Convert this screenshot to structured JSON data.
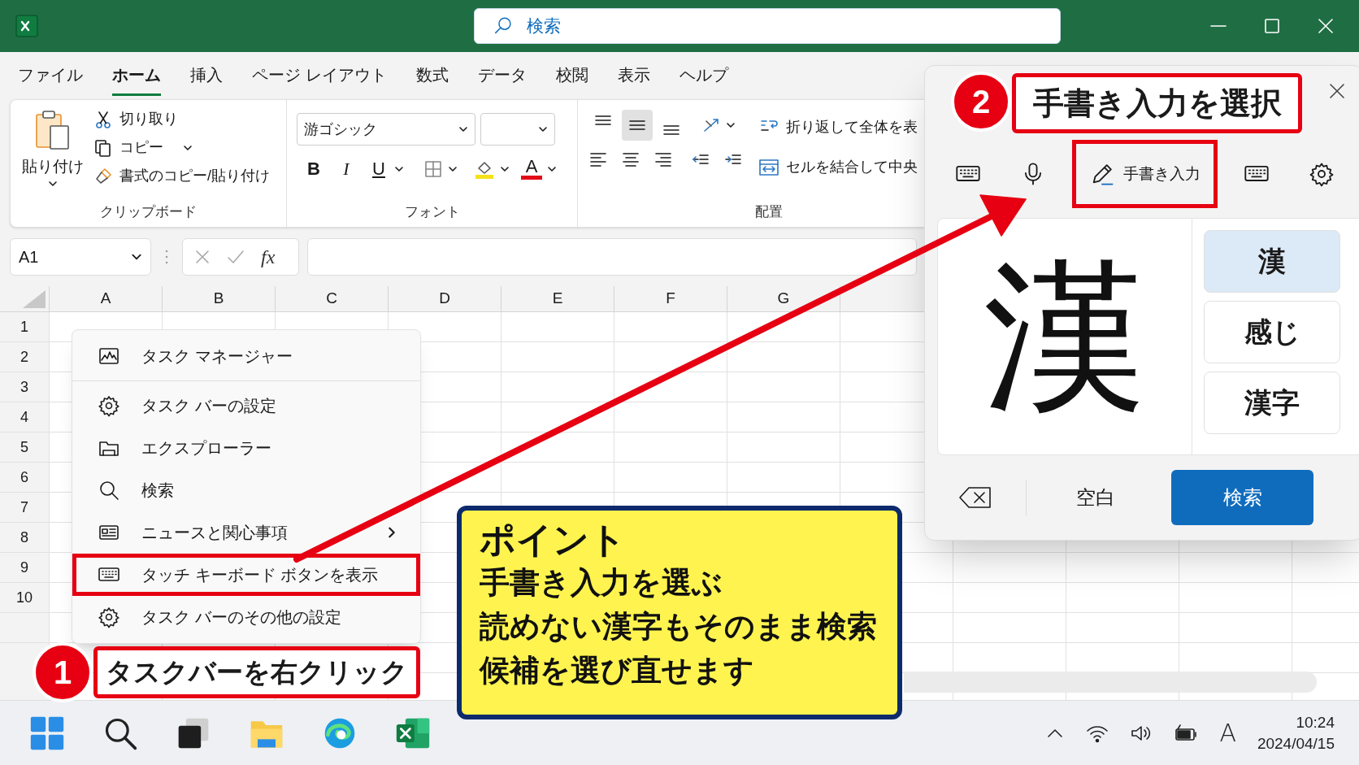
{
  "search": {
    "placeholder": "検索"
  },
  "ribbon_tabs": [
    {
      "label": "ファイル",
      "selected": false
    },
    {
      "label": "ホーム",
      "selected": true
    },
    {
      "label": "挿入",
      "selected": false
    },
    {
      "label": "ページ レイアウト",
      "selected": false
    },
    {
      "label": "数式",
      "selected": false
    },
    {
      "label": "データ",
      "selected": false
    },
    {
      "label": "校閲",
      "selected": false
    },
    {
      "label": "表示",
      "selected": false
    },
    {
      "label": "ヘルプ",
      "selected": false
    }
  ],
  "ribbon": {
    "clipboard": {
      "paste": "貼り付け",
      "commands": [
        {
          "kind": "cut",
          "label": "切り取り"
        },
        {
          "kind": "copy",
          "label": "コピー"
        },
        {
          "kind": "painter",
          "label": "書式のコピー/貼り付け"
        }
      ],
      "label": "クリップボード"
    },
    "font": {
      "font_name": "游ゴシック",
      "buttons": [
        "B",
        "I",
        "U"
      ],
      "font_color_button": "A",
      "label": "フォント"
    },
    "alignment": {
      "align_buttons": [
        {
          "kind": "top",
          "selected": false
        },
        {
          "kind": "middle",
          "selected": true
        },
        {
          "kind": "bottom",
          "selected": false
        }
      ],
      "commands": [
        {
          "kind": "wrap",
          "label": "折り返して全体を表"
        },
        {
          "kind": "merge",
          "label": "セルを結合して中央"
        }
      ],
      "label": "配置"
    }
  },
  "formula_bar": {
    "name_box": "A1",
    "function_button": "fx"
  },
  "sheet": {
    "columns": [
      "A",
      "B",
      "C",
      "D",
      "E",
      "F",
      "G"
    ],
    "rows": [
      "1",
      "2",
      "3",
      "4",
      "5",
      "6",
      "7",
      "8",
      "9",
      "10"
    ]
  },
  "context_menu": [
    {
      "kind": "taskmanager",
      "label": "タスク マネージャー",
      "submenu": false,
      "highlighted": false
    },
    {
      "kind": "settings",
      "label": "タスク バーの設定",
      "submenu": false,
      "highlighted": false
    },
    {
      "kind": "folder",
      "label": "エクスプローラー",
      "submenu": false,
      "highlighted": false
    },
    {
      "kind": "search",
      "label": "検索",
      "submenu": false,
      "highlighted": false
    },
    {
      "kind": "news",
      "label": "ニュースと関心事項",
      "submenu": true,
      "highlighted": false
    },
    {
      "kind": "keyboard",
      "label": "タッチ キーボード ボタンを表示",
      "submenu": false,
      "highlighted": true
    },
    {
      "kind": "settings",
      "label": "タスク バーのその他の設定",
      "submenu": false,
      "highlighted": false
    }
  ],
  "handwriting_panel": {
    "tools": [
      {
        "kind": "keyboard",
        "selected": false
      },
      {
        "kind": "mic",
        "selected": false
      },
      {
        "kind": "pen",
        "label": "手書き入力",
        "selected": true
      },
      {
        "kind": "keyboard",
        "selected": false
      },
      {
        "kind": "settings",
        "selected": false
      }
    ],
    "ink": "漢",
    "candidates": [
      {
        "label": "漢",
        "selected": true
      },
      {
        "label": "感じ",
        "selected": false
      },
      {
        "label": "漢字",
        "selected": false
      }
    ],
    "space_key": "空白",
    "search_button": "検索"
  },
  "steps": [
    {
      "number": "1",
      "label": "タスクバーを右クリック"
    },
    {
      "number": "2",
      "label": "手書き入力を選択"
    }
  ],
  "callout": {
    "title": "ポイント",
    "lines": [
      "手書き入力を選ぶ",
      "読めない漢字もそのまま検索",
      "候補を選び直せます"
    ]
  },
  "taskbar": {
    "apps": [
      {
        "kind": "start"
      },
      {
        "kind": "search"
      },
      {
        "kind": "taskview"
      },
      {
        "kind": "folder"
      },
      {
        "kind": "browser"
      },
      {
        "kind": "excel"
      }
    ],
    "ime": "A",
    "time": "10:24",
    "date": "2024/04/15"
  }
}
